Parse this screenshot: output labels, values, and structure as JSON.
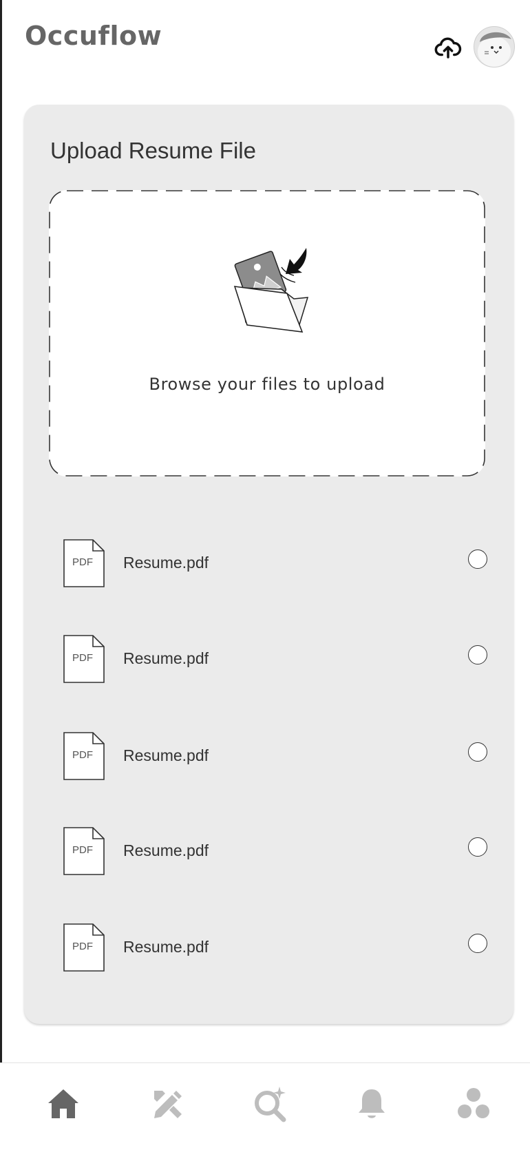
{
  "app": {
    "title": "Occuflow"
  },
  "header": {
    "upload_icon": "cloud-upload-icon",
    "avatar_icon": "avatar"
  },
  "upload_card": {
    "title": "Upload Resume File",
    "dropzone": {
      "illustration": "folder-upload-illustration",
      "text": "Browse your files to upload"
    },
    "files": [
      {
        "type_label": "PDF",
        "name": "Resume.pdf",
        "selected": false
      },
      {
        "type_label": "PDF",
        "name": "Resume.pdf",
        "selected": false
      },
      {
        "type_label": "PDF",
        "name": "Resume.pdf",
        "selected": false
      },
      {
        "type_label": "PDF",
        "name": "Resume.pdf",
        "selected": false
      },
      {
        "type_label": "PDF",
        "name": "Resume.pdf",
        "selected": false
      }
    ]
  },
  "bottom_nav": {
    "items": [
      {
        "icon": "home-icon",
        "active": true
      },
      {
        "icon": "edit-tools-icon",
        "active": false
      },
      {
        "icon": "search-sparkle-icon",
        "active": false
      },
      {
        "icon": "bell-icon",
        "active": false
      },
      {
        "icon": "community-icon",
        "active": false
      }
    ]
  },
  "colors": {
    "card_bg": "#ebebeb",
    "active_icon": "#666666",
    "inactive_icon": "#bdbdbd",
    "title_text": "#666666"
  }
}
